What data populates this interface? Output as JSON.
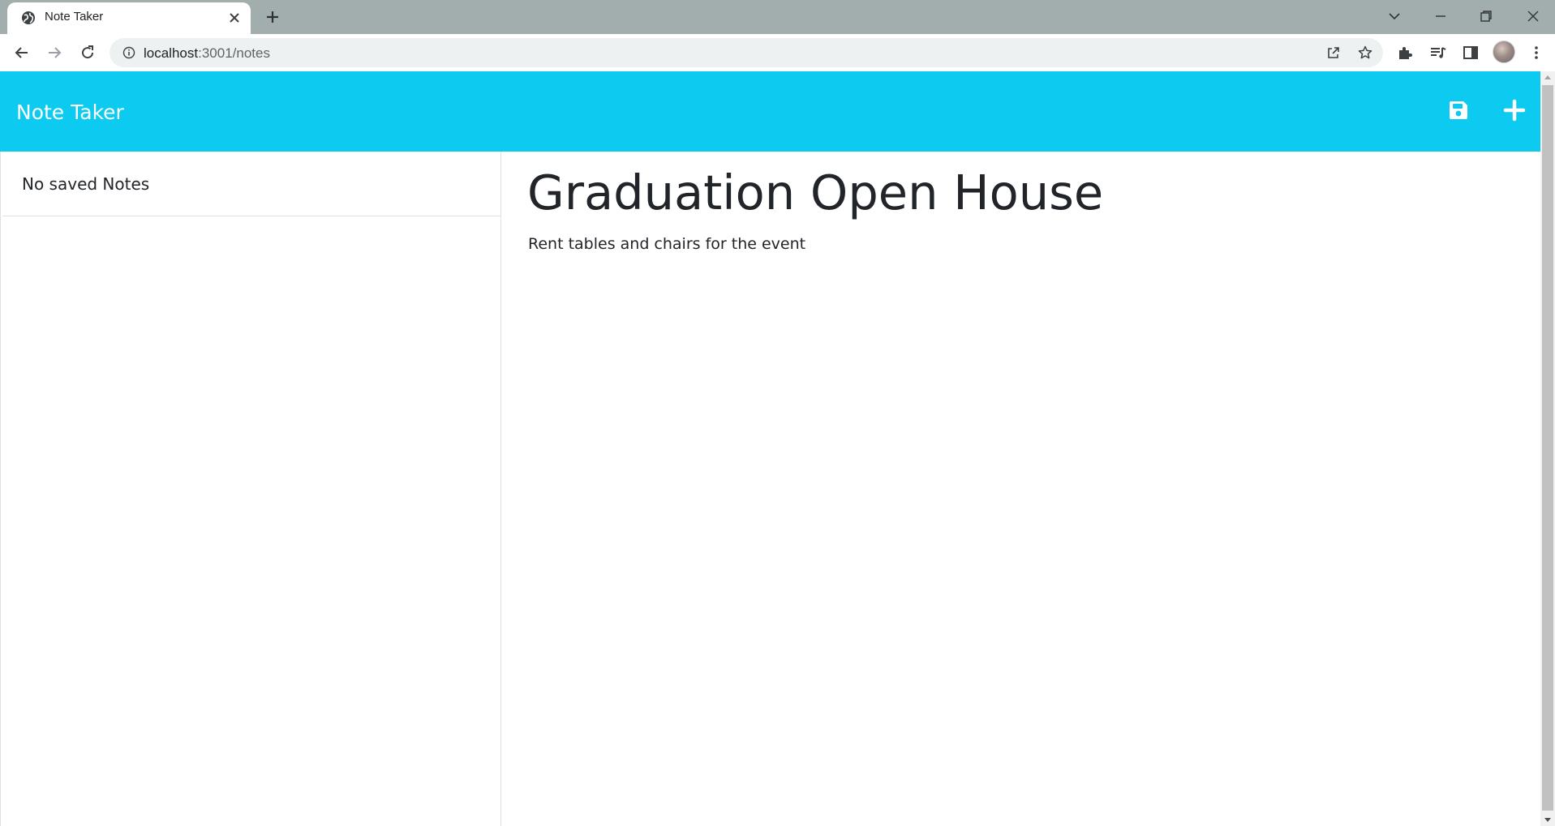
{
  "browser": {
    "tab_title": "Note Taker",
    "url_host": "localhost",
    "url_path": ":3001/notes"
  },
  "header": {
    "brand": "Note Taker",
    "background_color": "#0dcaf0",
    "save_icon": "floppy-disk-icon",
    "new_icon": "plus-icon"
  },
  "sidebar": {
    "empty_message": "No saved Notes"
  },
  "note": {
    "title": "Graduation Open House",
    "text": "Rent tables and chairs for the event"
  }
}
